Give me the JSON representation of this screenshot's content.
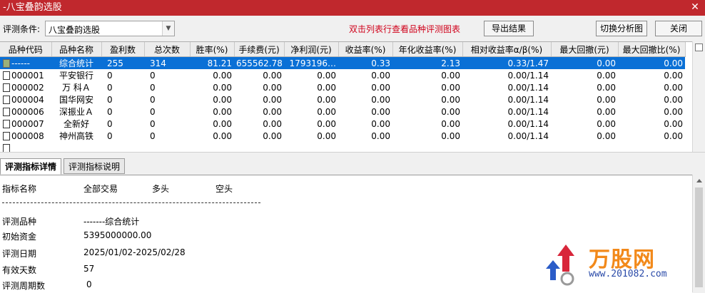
{
  "window": {
    "title": "-八宝叠韵选股",
    "close_glyph": "✕"
  },
  "toolbar": {
    "condition_label": "评测条件:",
    "condition_value": "八宝叠韵选股",
    "hint": "双击列表行查看品种评测图表",
    "export_label": "导出结果",
    "switch_label": "切换分析图",
    "close_label": "关闭"
  },
  "grid": {
    "columns": [
      "品种代码",
      "品种名称",
      "盈利数",
      "总次数",
      "胜率(%)",
      "手续费(元)",
      "净利润(元)",
      "收益率(%)",
      "年化收益率(%)",
      "相对收益率α/β(%)",
      "最大回撤(元)",
      "最大回撤比(%)"
    ],
    "rows": [
      {
        "code": "------",
        "name": "综合统计",
        "win": "255",
        "total": "314",
        "rate": "81.21",
        "fee": "655562.78",
        "profit": "1793196…",
        "ret": "0.33",
        "annual": "2.13",
        "rel": "0.33/1.47",
        "dd": "0.00",
        "ddr": "0.00"
      },
      {
        "code": "000001",
        "name": "平安银行",
        "win": "0",
        "total": "0",
        "rate": "0.00",
        "fee": "0.00",
        "profit": "0.00",
        "ret": "0.00",
        "annual": "0.00",
        "rel": "0.00/1.14",
        "dd": "0.00",
        "ddr": "0.00"
      },
      {
        "code": "000002",
        "name": "万 科Ａ",
        "win": "0",
        "total": "0",
        "rate": "0.00",
        "fee": "0.00",
        "profit": "0.00",
        "ret": "0.00",
        "annual": "0.00",
        "rel": "0.00/1.14",
        "dd": "0.00",
        "ddr": "0.00"
      },
      {
        "code": "000004",
        "name": "国华网安",
        "win": "0",
        "total": "0",
        "rate": "0.00",
        "fee": "0.00",
        "profit": "0.00",
        "ret": "0.00",
        "annual": "0.00",
        "rel": "0.00/1.14",
        "dd": "0.00",
        "ddr": "0.00"
      },
      {
        "code": "000006",
        "name": "深振业Ａ",
        "win": "0",
        "total": "0",
        "rate": "0.00",
        "fee": "0.00",
        "profit": "0.00",
        "ret": "0.00",
        "annual": "0.00",
        "rel": "0.00/1.14",
        "dd": "0.00",
        "ddr": "0.00"
      },
      {
        "code": "000007",
        "name": "全新好",
        "win": "0",
        "total": "0",
        "rate": "0.00",
        "fee": "0.00",
        "profit": "0.00",
        "ret": "0.00",
        "annual": "0.00",
        "rel": "0.00/1.14",
        "dd": "0.00",
        "ddr": "0.00"
      },
      {
        "code": "000008",
        "name": "神州高铁",
        "win": "0",
        "total": "0",
        "rate": "0.00",
        "fee": "0.00",
        "profit": "0.00",
        "ret": "0.00",
        "annual": "0.00",
        "rel": "0.00/1.14",
        "dd": "0.00",
        "ddr": "0.00"
      }
    ]
  },
  "tabs": [
    {
      "label": "评测指标详情"
    },
    {
      "label": "评测指标说明"
    }
  ],
  "detail": {
    "headers": [
      "指标名称",
      "全部交易",
      "多头",
      "空头"
    ],
    "rows": [
      {
        "label": "评测品种",
        "value": "-------综合统计"
      },
      {
        "label": "初始资金",
        "value": "5395000000.00"
      },
      {
        "label": "评测日期",
        "value": "2025/01/02-2025/02/28"
      },
      {
        "label": "有效天数",
        "value": "57"
      },
      {
        "label": "评测周期数",
        "value": "0"
      }
    ]
  },
  "watermark": {
    "brand": "万股网",
    "url": "www.201082.com"
  },
  "colors": {
    "titlebar": "#c0282d",
    "selection": "#0a70d6",
    "hint": "#d0021b"
  }
}
